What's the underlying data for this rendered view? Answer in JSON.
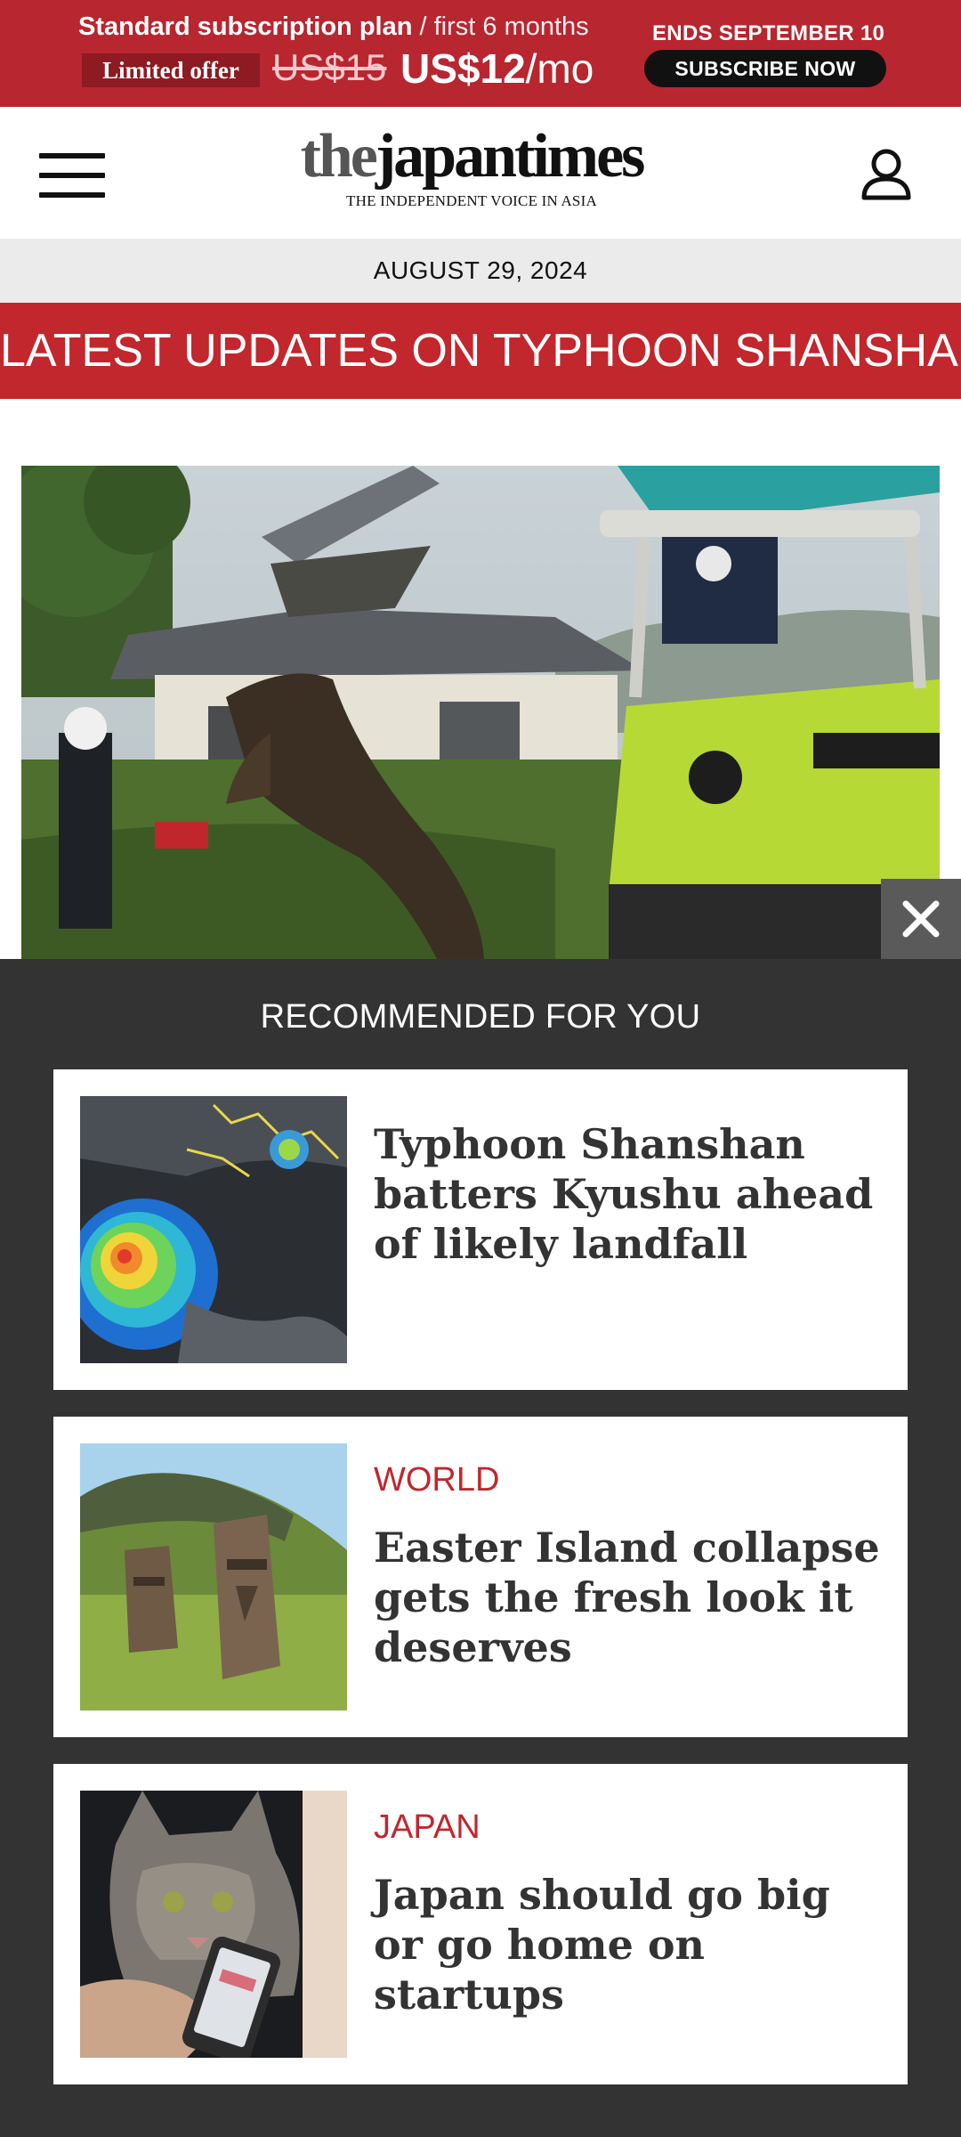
{
  "promo": {
    "plan_text": "Standard subscription plan",
    "duration_text": " / first 6 months",
    "offer_badge": "Limited offer",
    "old_price": "US$15",
    "new_price": "US$12",
    "price_period": "/mo",
    "ends_text": "ENDS SEPTEMBER 10",
    "cta_label": "SUBSCRIBE NOW"
  },
  "header": {
    "menu_icon": "hamburger-menu-icon",
    "logo_the": "the",
    "logo_japan": "japan",
    "logo_times": "times",
    "tagline": "THE INDEPENDENT VOICE IN ASIA",
    "account_icon": "user-account-icon"
  },
  "date": "AUGUST 29, 2024",
  "breaking": "LATEST UPDATES ON TYPHOON SHANSHAN",
  "overlay": {
    "close_icon": "close-icon",
    "title": "RECOMMENDED FOR YOU",
    "items": [
      {
        "section": "",
        "headline": "Typhoon Shanshan batters Kyushu ahead of likely landfall"
      },
      {
        "section": "WORLD",
        "headline": "Easter Island collapse gets the fresh look it deserves"
      },
      {
        "section": "JAPAN",
        "headline": "Japan should go big or go home on startups"
      }
    ]
  },
  "colors": {
    "brand_red": "#c1272d",
    "overlay_bg": "#333333"
  }
}
